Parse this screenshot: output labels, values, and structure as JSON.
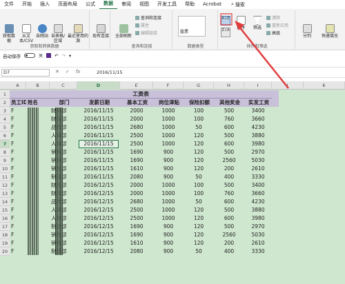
{
  "menu": [
    "文件",
    "开始",
    "插入",
    "页面布局",
    "公式",
    "数据",
    "审阅",
    "视图",
    "开发工具",
    "帮助",
    "Acrobat"
  ],
  "menu_active_index": 5,
  "search_label": "搜索",
  "ribbon": {
    "get_data": "获取数据",
    "from_text_csv": "从文本/CSV",
    "from_web": "自网站",
    "from_table": "自表格/区域",
    "recent_sources": "最近使用的源",
    "existing_conn": "现有连接",
    "group1_title": "获取和转换数据",
    "refresh_all": "全部刷新",
    "queries_conn": "查询和连接",
    "properties": "属性",
    "edit_links": "编辑链接",
    "group2_title": "查询和连接",
    "stocks": "股票",
    "group3_title": "数据类型",
    "sort": "排序",
    "filter": "筛选",
    "clear": "清除",
    "reapply": "重新应用",
    "advanced": "高级",
    "group4_title": "排序和筛选",
    "split_columns": "分列",
    "flash_fill": "快速填充"
  },
  "qat": {
    "autosave": "自动保存",
    "autosave_state": "关"
  },
  "formula_bar": {
    "name_box": "D7",
    "cancel": "✕",
    "confirm": "✓",
    "fx": "fx",
    "value": "2016/11/15"
  },
  "columns": [
    "A",
    "B",
    "C",
    "D",
    "E",
    "F",
    "G",
    "H",
    "I",
    "J",
    "K"
  ],
  "selected_column": "D",
  "selected_row": 7,
  "sheet_title": "工资表",
  "headers": [
    "员工ID",
    "姓名",
    "部门",
    "发薪日期",
    "基本工资",
    "岗位津贴",
    "保险扣额",
    "其他奖金",
    "实发工资"
  ],
  "rows": [
    [
      "F",
      "",
      "财务部",
      "2016/11/15",
      "2000",
      "1000",
      "100",
      "500",
      "3400"
    ],
    [
      "F",
      "",
      "财务部",
      "2016/11/15",
      "2000",
      "1000",
      "100",
      "760",
      "3660"
    ],
    [
      "F",
      "",
      "品质部",
      "2016/11/15",
      "2680",
      "1000",
      "50",
      "600",
      "4230"
    ],
    [
      "F",
      "",
      "人事部",
      "2016/11/15",
      "2500",
      "1000",
      "120",
      "500",
      "3880"
    ],
    [
      "F",
      "",
      "人事部",
      "2016/11/15",
      "2500",
      "1000",
      "120",
      "600",
      "3980"
    ],
    [
      "F",
      "",
      "销售部",
      "2016/11/15",
      "1690",
      "900",
      "120",
      "500",
      "2970"
    ],
    [
      "F",
      "",
      "销售部",
      "2016/11/15",
      "1690",
      "900",
      "120",
      "2560",
      "5030"
    ],
    [
      "F",
      "",
      "销售部",
      "2016/11/15",
      "1610",
      "900",
      "120",
      "200",
      "2610"
    ],
    [
      "F",
      "",
      "制造部",
      "2016/11/15",
      "2080",
      "900",
      "50",
      "400",
      "3330"
    ],
    [
      "F",
      "",
      "财务部",
      "2016/12/15",
      "2000",
      "1000",
      "100",
      "500",
      "3400"
    ],
    [
      "F",
      "",
      "财务部",
      "2016/12/15",
      "2000",
      "1000",
      "100",
      "760",
      "3660"
    ],
    [
      "F",
      "",
      "品质部",
      "2016/12/15",
      "2680",
      "1000",
      "50",
      "600",
      "4230"
    ],
    [
      "F",
      "",
      "人事部",
      "2016/12/15",
      "2500",
      "1000",
      "120",
      "500",
      "3880"
    ],
    [
      "F",
      "",
      "人事部",
      "2016/12/15",
      "2500",
      "1000",
      "120",
      "600",
      "3980"
    ],
    [
      "F",
      "",
      "制造部",
      "2016/12/15",
      "1690",
      "900",
      "120",
      "500",
      "2970"
    ],
    [
      "F",
      "",
      "销售部",
      "2016/12/15",
      "1690",
      "900",
      "120",
      "2560",
      "5030"
    ],
    [
      "F",
      "",
      "销售部",
      "2016/12/15",
      "1610",
      "900",
      "120",
      "200",
      "2610"
    ],
    [
      "F",
      "",
      "制造部",
      "2016/12/15",
      "2080",
      "900",
      "50",
      "400",
      "3330"
    ]
  ],
  "colors": {
    "accent": "#217346",
    "header_band": "#c9c0d9",
    "sheet_bg": "#cfe7cf",
    "arrow": "#e03c3c"
  }
}
